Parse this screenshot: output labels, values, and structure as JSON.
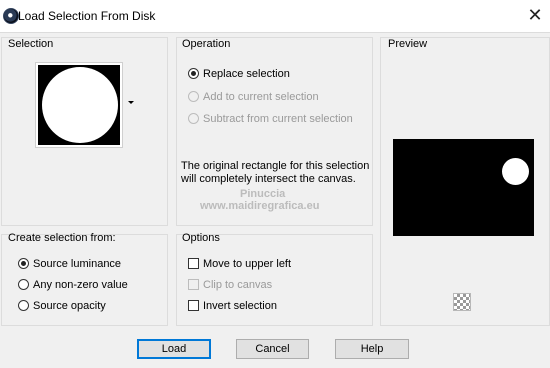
{
  "window": {
    "title": "Load Selection From Disk",
    "close_symbol": "✕"
  },
  "selection_group": {
    "label": "Selection"
  },
  "operation_group": {
    "label": "Operation",
    "options": [
      {
        "label": "Replace selection",
        "selected": true,
        "enabled": true
      },
      {
        "label": "Add to current selection",
        "selected": false,
        "enabled": false
      },
      {
        "label": "Subtract from current selection",
        "selected": false,
        "enabled": false
      }
    ],
    "description": "The original rectangle for this selection will completely intersect the canvas."
  },
  "preview_group": {
    "label": "Preview"
  },
  "create_group": {
    "label": "Create selection from:",
    "options": [
      {
        "label": "Source luminance",
        "selected": true
      },
      {
        "label": "Any non-zero value",
        "selected": false
      },
      {
        "label": "Source opacity",
        "selected": false
      }
    ]
  },
  "options_group": {
    "label": "Options",
    "options": [
      {
        "label": "Move to upper left",
        "checked": false,
        "enabled": true
      },
      {
        "label": "Clip to canvas",
        "checked": false,
        "enabled": false
      },
      {
        "label": "Invert selection",
        "checked": false,
        "enabled": true
      }
    ]
  },
  "buttons": {
    "load": "Load",
    "cancel": "Cancel",
    "help": "Help"
  },
  "watermark": {
    "line1": "Pinuccia",
    "line2": "www.maidiregrafica.eu"
  },
  "colors": {
    "accent": "#0078d7",
    "disabled_text": "#9a9a9a"
  }
}
